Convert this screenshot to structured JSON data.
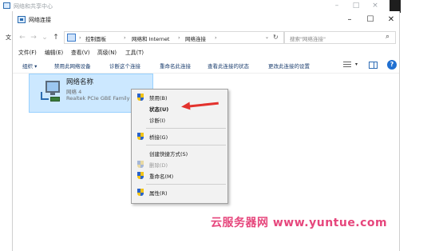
{
  "background_window": {
    "title": "网络和共享中心",
    "caption_minimize": "–",
    "caption_maximize": "□",
    "caption_close": "×",
    "edge_letter": "文"
  },
  "window": {
    "title": "网络连接",
    "caption_minimize": "–",
    "caption_maximize": "☐",
    "caption_close": "✕"
  },
  "navigation": {
    "back": "←",
    "forward": "→",
    "recent": "⌄",
    "up": "↑",
    "breadcrumb": [
      "控制面板",
      "网络和 Internet",
      "网络连接"
    ],
    "separator": "›",
    "dropdown": "⌄",
    "refresh": "↻",
    "search_placeholder": "搜索\"网络连接\"",
    "search_icon": "⌕"
  },
  "menubar": [
    "文件(F)",
    "编辑(E)",
    "查看(V)",
    "高级(N)",
    "工具(T)"
  ],
  "commandbar": {
    "organize": "组织 ▾",
    "commands": [
      "禁用此网络设备",
      "诊断这个连接",
      "重命名此连接",
      "查看此连接的状态",
      "更改此连接的设置"
    ],
    "view_dropdown": "▾",
    "help": "?"
  },
  "connection": {
    "name": "网络名称",
    "subtitle": "网络 4",
    "device": "Realtek PCIe GBE Family Controller"
  },
  "context_menu": {
    "items": [
      {
        "label": "禁用(B)",
        "icon": "shield-icon",
        "bold": false,
        "disabled": false
      },
      {
        "label": "状态(U)",
        "icon": "",
        "bold": true,
        "disabled": false
      },
      {
        "label": "诊断(I)",
        "icon": "",
        "bold": false,
        "disabled": false
      },
      {
        "label": "桥接(G)",
        "icon": "shield-icon",
        "bold": false,
        "disabled": false
      },
      {
        "label": "创建快捷方式(S)",
        "icon": "",
        "bold": false,
        "disabled": false
      },
      {
        "label": "删除(D)",
        "icon": "shield-icon",
        "bold": false,
        "disabled": true
      },
      {
        "label": "重命名(M)",
        "icon": "shield-icon",
        "bold": false,
        "disabled": false
      },
      {
        "label": "属性(R)",
        "icon": "shield-icon",
        "bold": false,
        "disabled": false
      }
    ]
  },
  "watermark": "云服务器网 www.yuntue.com",
  "colors": {
    "selection_bg": "#cce8ff",
    "annotation_arrow": "#e3322d",
    "watermark": "#e6467c",
    "help_button": "#1f6fd1"
  }
}
